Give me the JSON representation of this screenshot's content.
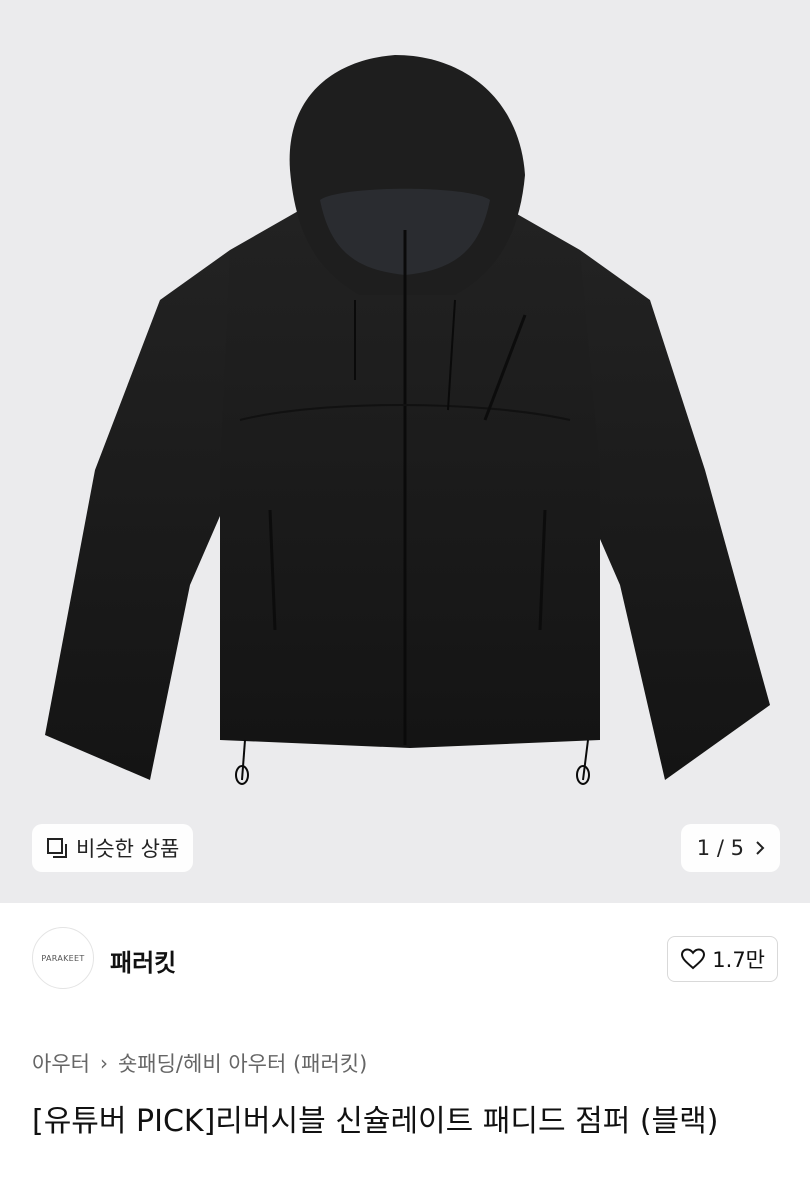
{
  "product": {
    "image_alt": "black hooded padded jacket",
    "similar_label": "비슷한 상품",
    "page_current": "1",
    "page_separator": "/",
    "page_total": "5",
    "next_icon": "chevron-right-icon"
  },
  "brand": {
    "logo_text": "PARAKEET",
    "name": "패러킷",
    "likes": "1.7만",
    "like_icon": "heart-icon"
  },
  "breadcrumb": {
    "category": "아우터",
    "subcategory": "숏패딩/헤비 아우터 (패러킷)"
  },
  "title": "[유튜버 PICK]리버시블 신슐레이트 패디드 점퍼 (블랙)",
  "colors": {
    "hero_bg": "#ebebed",
    "jacket": "#1b1b1b"
  }
}
